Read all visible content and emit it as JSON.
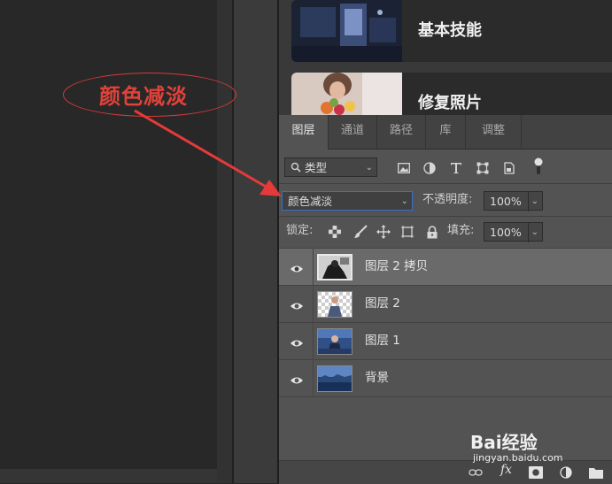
{
  "learn_cards": [
    {
      "title": "基本技能"
    },
    {
      "title": "修复照片"
    }
  ],
  "tabs": [
    "图层",
    "通道",
    "路径",
    "库",
    "调整"
  ],
  "filter": {
    "kind_label": "类型"
  },
  "blend": {
    "mode": "颜色减淡",
    "opacity_label": "不透明度:",
    "opacity_value": "100%"
  },
  "lock": {
    "label": "锁定:",
    "fill_label": "填充:",
    "fill_value": "100%"
  },
  "layers": [
    {
      "name": "图层 2 拷贝",
      "selected": true
    },
    {
      "name": "图层 2",
      "selected": false
    },
    {
      "name": "图层 1",
      "selected": false
    },
    {
      "name": "背景",
      "selected": false
    }
  ],
  "bottom_bar": {
    "fx_label": "fx"
  },
  "annotation": {
    "text": "颜色减淡",
    "color": "#e0423a"
  },
  "watermark": {
    "brand": "Bai经验",
    "url": "jingyan.baidu.com"
  }
}
